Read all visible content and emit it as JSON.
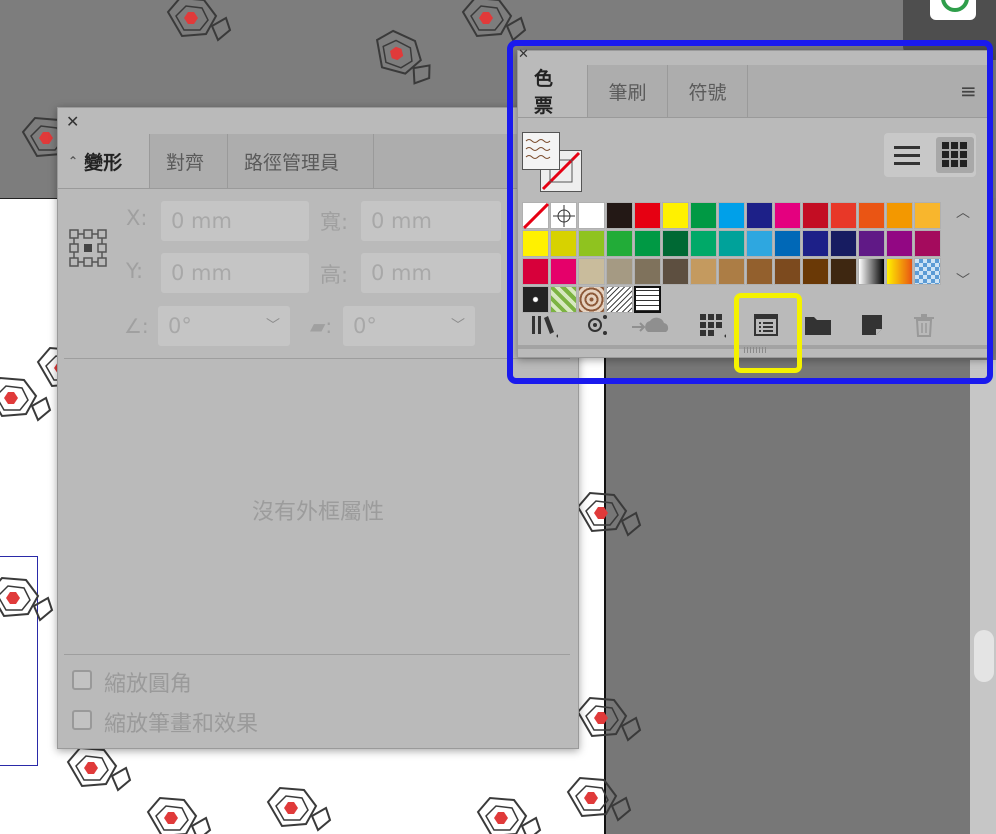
{
  "transform_panel": {
    "tabs": [
      "變形",
      "對齊",
      "路徑管理員"
    ],
    "x_label": "X:",
    "x_value": "0 mm",
    "y_label": "Y:",
    "y_value": "0 mm",
    "w_label": "寬:",
    "w_value": "0 mm",
    "h_label": "高:",
    "h_value": "0 mm",
    "angle_value": "0°",
    "shear_value": "0°",
    "empty_message": "沒有外框屬性",
    "checkbox_scale_corners": "縮放圓角",
    "checkbox_scale_strokes": "縮放筆畫和效果"
  },
  "swatches_panel": {
    "tabs": [
      "色票",
      "筆刷",
      "符號"
    ],
    "swatch_rows": [
      [
        "none",
        "registration",
        "#ffffff",
        "#231815",
        "#e60012",
        "#fff100",
        "#009944",
        "#00a0e9",
        "#1d2088",
        "#e4007f",
        "#c30d23",
        "#e83828",
        "#ea5514",
        "#f39800",
        "#f8b62d"
      ],
      [
        "#fff100",
        "#d7d200",
        "#8fc31f",
        "#22ac38",
        "#009944",
        "#006934",
        "#00a968",
        "#00a29a",
        "#2ea7e0",
        "#0068b7",
        "#1d2088",
        "#171c61",
        "#601986",
        "#920783",
        "#a40b5d"
      ],
      [
        "#d7003a",
        "#e5006a",
        "#c9bc9c",
        "#a59a83",
        "#7f725c",
        "#5d4f40",
        "#c49a5f",
        "#ac7d45",
        "#93602d",
        "#7c4a1e",
        "#6a3906",
        "#3e2711",
        "gradient-bw",
        "gradient-yellow",
        "gradient-blue"
      ]
    ],
    "pattern_swatches": [
      "pattern-dots",
      "pattern-leaves",
      "pattern-swirl",
      "pattern-scales",
      "pattern-waves"
    ]
  },
  "colors": {
    "highlight_blue": "#1a1aee",
    "highlight_yellow": "#f4f200",
    "motif_red": "#e03a3a"
  }
}
